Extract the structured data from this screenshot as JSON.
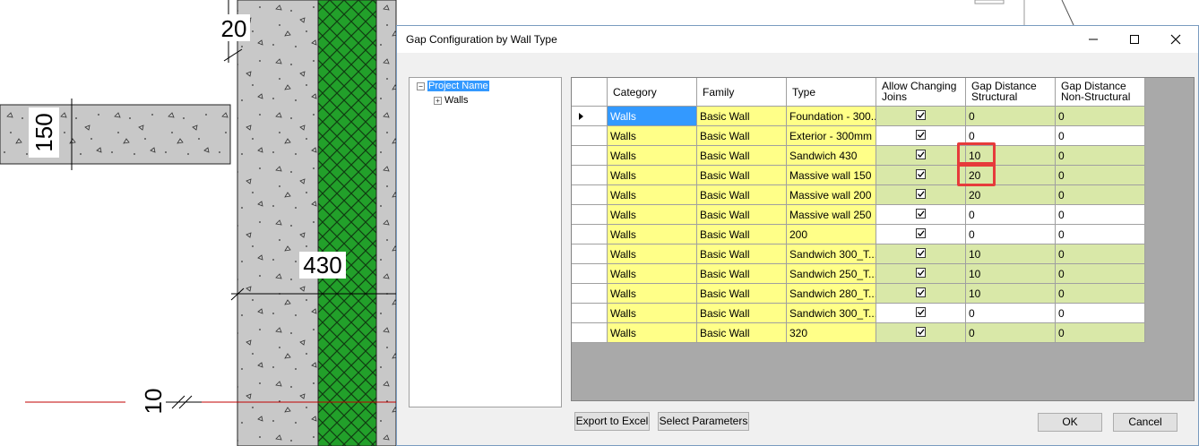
{
  "drawing": {
    "dimensions": [
      "20",
      "150",
      "430",
      "10"
    ]
  },
  "dialog": {
    "title": "Gap Configuration by Wall Type",
    "tree": {
      "root": "Project Name",
      "child": "Walls"
    },
    "grid": {
      "columns": [
        "Category",
        "Family",
        "Type",
        "Allow Changing Joins",
        "Gap Distance Structural",
        "Gap Distance Non-Structural"
      ],
      "header_lines": [
        [
          "Category"
        ],
        [
          "Family"
        ],
        [
          "Type"
        ],
        [
          "Allow Changing",
          "Joins"
        ],
        [
          "Gap Distance",
          "Structural"
        ],
        [
          "Gap Distance",
          "Non-Structural"
        ]
      ],
      "rows": [
        {
          "category": "Walls",
          "family": "Basic Wall",
          "type": "Foundation - 300...",
          "allow": true,
          "gap_s": "0",
          "gap_ns": "0",
          "color": "green",
          "selected": true
        },
        {
          "category": "Walls",
          "family": "Basic Wall",
          "type": "Exterior - 300mm ...",
          "allow": true,
          "gap_s": "0",
          "gap_ns": "0",
          "color": "white"
        },
        {
          "category": "Walls",
          "family": "Basic Wall",
          "type": "Sandwich 430",
          "allow": true,
          "gap_s": "10",
          "gap_ns": "0",
          "color": "green"
        },
        {
          "category": "Walls",
          "family": "Basic Wall",
          "type": "Massive wall 150",
          "allow": true,
          "gap_s": "20",
          "gap_ns": "0",
          "color": "green"
        },
        {
          "category": "Walls",
          "family": "Basic Wall",
          "type": "Massive wall 200",
          "allow": true,
          "gap_s": "20",
          "gap_ns": "0",
          "color": "green"
        },
        {
          "category": "Walls",
          "family": "Basic Wall",
          "type": "Massive wall 250",
          "allow": true,
          "gap_s": "0",
          "gap_ns": "0",
          "color": "white"
        },
        {
          "category": "Walls",
          "family": "Basic Wall",
          "type": "200",
          "allow": true,
          "gap_s": "0",
          "gap_ns": "0",
          "color": "white"
        },
        {
          "category": "Walls",
          "family": "Basic Wall",
          "type": "Sandwich 300_T...",
          "allow": true,
          "gap_s": "10",
          "gap_ns": "0",
          "color": "green"
        },
        {
          "category": "Walls",
          "family": "Basic Wall",
          "type": "Sandwich 250_T...",
          "allow": true,
          "gap_s": "10",
          "gap_ns": "0",
          "color": "green"
        },
        {
          "category": "Walls",
          "family": "Basic Wall",
          "type": "Sandwich 280_T...",
          "allow": true,
          "gap_s": "10",
          "gap_ns": "0",
          "color": "green"
        },
        {
          "category": "Walls",
          "family": "Basic Wall",
          "type": "Sandwich 300_T...",
          "allow": true,
          "gap_s": "0",
          "gap_ns": "0",
          "color": "white"
        },
        {
          "category": "Walls",
          "family": "Basic Wall",
          "type": "320",
          "allow": true,
          "gap_s": "0",
          "gap_ns": "0",
          "color": "green"
        }
      ]
    },
    "buttons": {
      "export": "Export to Excel",
      "select_params": "Select Parameters",
      "ok": "OK",
      "cancel": "Cancel"
    },
    "colors": {
      "yellow": "#ffff88",
      "green": "#d9e8a8",
      "highlight": "#e63b3b",
      "selection": "#3399ff"
    }
  }
}
